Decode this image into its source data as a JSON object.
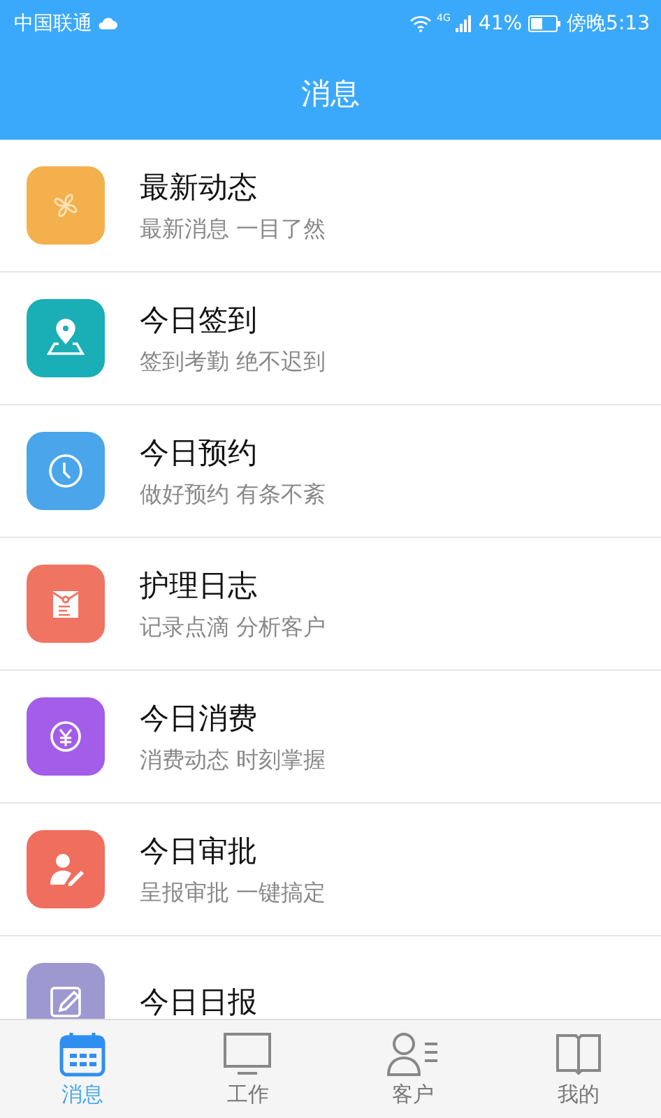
{
  "status_bar": {
    "carrier": "中国联通",
    "network": "4G",
    "battery": "41%",
    "time": "傍晚5:13"
  },
  "header": {
    "title": "消息"
  },
  "items": [
    {
      "title": "最新动态",
      "subtitle": "最新消息 一目了然",
      "color": "#f5b04e"
    },
    {
      "title": "今日签到",
      "subtitle": "签到考勤 绝不迟到",
      "color": "#1aaeb6"
    },
    {
      "title": "今日预约",
      "subtitle": "做好预约 有条不紊",
      "color": "#4aa5ea"
    },
    {
      "title": "护理日志",
      "subtitle": "记录点滴 分析客户",
      "color": "#f07462"
    },
    {
      "title": "今日消费",
      "subtitle": "消费动态 时刻掌握",
      "color": "#a35de9"
    },
    {
      "title": "今日审批",
      "subtitle": "呈报审批 一键搞定",
      "color": "#f06e5e"
    },
    {
      "title": "今日日报",
      "color": "#9d98cf"
    }
  ],
  "tabs": [
    {
      "label": "消息",
      "selected": true
    },
    {
      "label": "工作",
      "selected": false
    },
    {
      "label": "客户",
      "selected": false
    },
    {
      "label": "我的",
      "selected": false
    }
  ]
}
